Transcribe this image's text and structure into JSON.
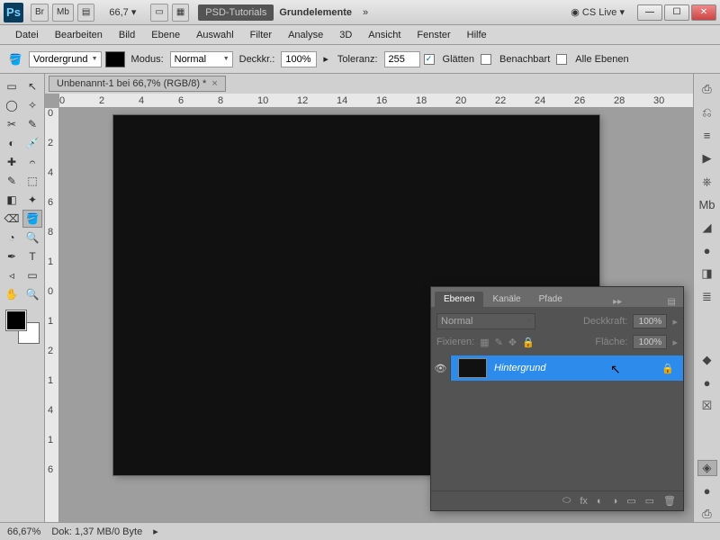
{
  "titlebar": {
    "zoom_value": "66,7",
    "tutorials_label": "PSD-Tutorials",
    "workspace_label": "Grundelemente",
    "cslive_label": "CS Live"
  },
  "menus": [
    "Datei",
    "Bearbeiten",
    "Bild",
    "Ebene",
    "Auswahl",
    "Filter",
    "Analyse",
    "3D",
    "Ansicht",
    "Fenster",
    "Hilfe"
  ],
  "options": {
    "fill_label": "Vordergrund",
    "mode_label": "Modus:",
    "mode_value": "Normal",
    "opacity_label": "Deckkr.:",
    "opacity_value": "100%",
    "tolerance_label": "Toleranz:",
    "tolerance_value": "255",
    "antialias_label": "Glätten",
    "contiguous_label": "Benachbart",
    "alllayers_label": "Alle Ebenen",
    "antialias_checked": "✓"
  },
  "document": {
    "tab_title": "Unbenannt-1 bei 66,7% (RGB/8) *",
    "ruler_marks": [
      "0",
      "2",
      "4",
      "6",
      "8",
      "10",
      "12",
      "14",
      "16",
      "18",
      "20",
      "22",
      "24",
      "26",
      "28",
      "30"
    ],
    "ruler_v_marks": [
      "0",
      "2",
      "4",
      "6",
      "8",
      "1",
      "0",
      "1",
      "2",
      "1",
      "4",
      "1",
      "6"
    ]
  },
  "layers_panel": {
    "tabs": [
      "Ebenen",
      "Kanäle",
      "Pfade"
    ],
    "blend_value": "Normal",
    "opacity_label": "Deckkraft:",
    "opacity_value": "100%",
    "fix_label": "Fixieren:",
    "fill_label": "Fläche:",
    "fill_value": "100%",
    "layer_name": "Hintergrund"
  },
  "status": {
    "zoom": "66,67%",
    "docinfo": "Dok: 1,37 MB/0 Byte"
  },
  "icons": {
    "br": "Br",
    "mb": "Mb",
    "film": "▤",
    "screen": "▭",
    "arrange": "▦",
    "chevrons": "»",
    "globe": "◉",
    "min": "—",
    "max": "☐",
    "close": "✕",
    "bucket": "🪣",
    "arrow": "▸",
    "link": "⬭",
    "fx": "fx",
    "mask": "◐",
    "adjust": "◑",
    "group": "▭",
    "new": "▭",
    "trash": "🗑",
    "eye": "👁",
    "lock": "🔒",
    "cursor": "↖"
  },
  "tools": [
    "▭",
    "↖",
    "◯",
    "✧",
    "✂",
    "✎",
    "◐",
    "💉",
    "✚",
    "𝄐",
    "✎",
    "⬚",
    "◧",
    "✦",
    "⌫",
    "🪣",
    "◔",
    "🔍",
    "✒",
    "T",
    "◃",
    "▭",
    "✋",
    "🔍"
  ],
  "dockicons": [
    "⎙",
    "⎌",
    "≡",
    "▶",
    "⎈",
    "Mb",
    "◢",
    "●",
    "◨",
    "≣",
    "",
    "◆",
    "●",
    "☒",
    "",
    "◈",
    "●",
    "⎙"
  ]
}
